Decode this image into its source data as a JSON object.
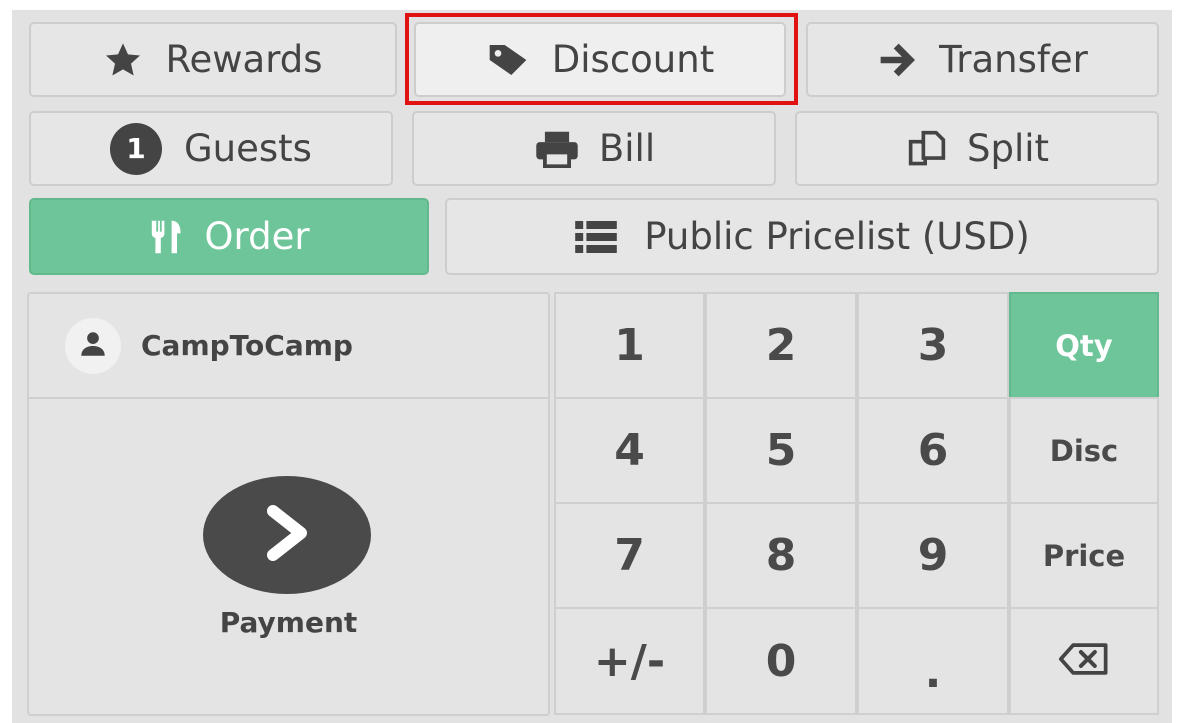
{
  "actions": {
    "rewards": {
      "label": "Rewards",
      "icon": "star-icon"
    },
    "discount": {
      "label": "Discount",
      "icon": "tag-icon"
    },
    "transfer": {
      "label": "Transfer",
      "icon": "arrow-right-icon"
    },
    "guests": {
      "label": "Guests",
      "count": "1"
    },
    "bill": {
      "label": "Bill",
      "icon": "printer-icon"
    },
    "split": {
      "label": "Split",
      "icon": "copy-icon"
    },
    "order": {
      "label": "Order",
      "icon": "cutlery-icon"
    },
    "pricelist": {
      "label": "Public Pricelist (USD)",
      "icon": "list-icon"
    }
  },
  "customer": {
    "name": "CampToCamp",
    "icon": "user-icon"
  },
  "payment": {
    "label": "Payment",
    "icon": "chevron-right-icon"
  },
  "numpad": {
    "keys": {
      "k1": "1",
      "k2": "2",
      "k3": "3",
      "k4": "4",
      "k5": "5",
      "k6": "6",
      "k7": "7",
      "k8": "8",
      "k9": "9",
      "plusminus": "+/-",
      "k0": "0",
      "dot": "."
    },
    "modes": {
      "qty": "Qty",
      "disc": "Disc",
      "price": "Price"
    },
    "active_mode": "Qty",
    "backspace_icon": "backspace-icon"
  },
  "colors": {
    "accent": "#6ec59a",
    "highlight": "#e01212",
    "dark": "#444444"
  }
}
